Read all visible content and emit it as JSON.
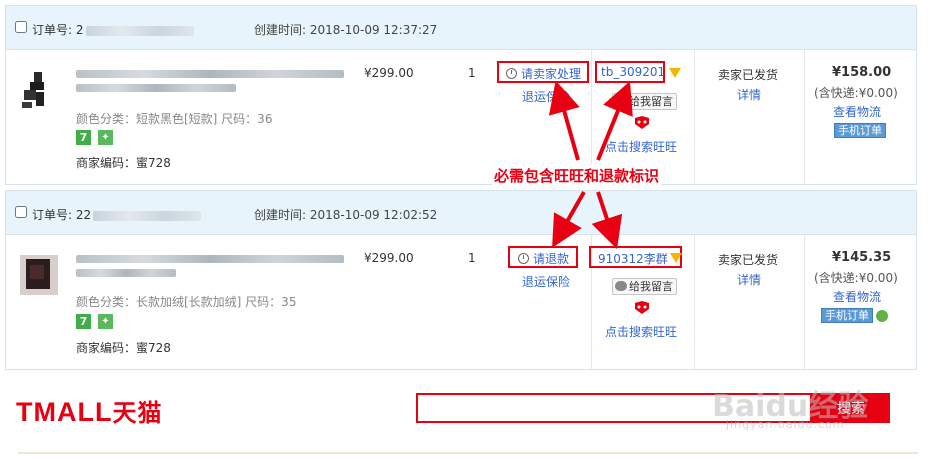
{
  "orders": [
    {
      "order_no_label": "订单号: 2",
      "created": "创建时间: 2018-10-09 12:37:27",
      "sku": "颜色分类：短款黑色[短款]  尺码：36",
      "code": "商家编码：蜜728",
      "price": "¥299.00",
      "qty": "1",
      "refund_action": "请卖家处理",
      "return_insurance": "退运保险",
      "buyer_id": "tb_309201",
      "message": "给我留言",
      "search_ww": "点击搜索旺旺",
      "status": "卖家已发货",
      "detail": "详情",
      "total": "¥158.00",
      "shipping": "(含快递:¥0.00)",
      "logistics": "查看物流",
      "mobile_order": "手机订单"
    },
    {
      "order_no_label": "订单号: 22",
      "created": "创建时间: 2018-10-09 12:02:52",
      "sku": "颜色分类：长款加绒[长款加绒]  尺码：35",
      "code": "商家编码：蜜728",
      "price": "¥299.00",
      "qty": "1",
      "refund_action": "请退款",
      "return_insurance": "退运保险",
      "buyer_id": "910312李群",
      "message": "给我留言",
      "search_ww": "点击搜索旺旺",
      "status": "卖家已发货",
      "detail": "详情",
      "total": "¥145.35",
      "shipping": "(含快递:¥0.00)",
      "logistics": "查看物流",
      "mobile_order": "手机订单"
    }
  ],
  "annotation": "必需包含旺旺和退款标识",
  "footer": {
    "logo_text": "TMALL",
    "logo_cn": "天猫",
    "search_button": "搜索"
  },
  "watermark": {
    "main": "Baidu经验",
    "sub": "jingyan.baidu.com"
  },
  "colors": {
    "accent": "#e60012",
    "link": "#3366cc",
    "header_bg": "#e8f4fb"
  }
}
